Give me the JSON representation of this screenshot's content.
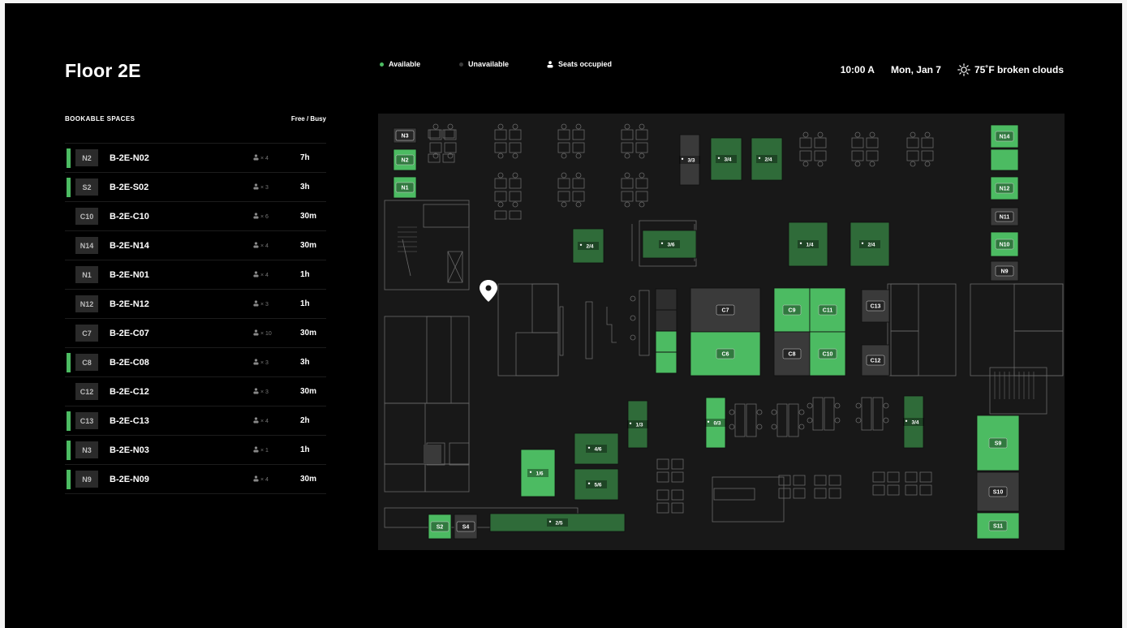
{
  "header": {
    "title": "Floor 2E"
  },
  "legend": [
    {
      "label": "Available",
      "color": "#4cbb62",
      "icon": "dot"
    },
    {
      "label": "Unavailable",
      "color": "#3a3a3a",
      "icon": "dot"
    },
    {
      "label": "Seats occupied",
      "color": "#ffffff",
      "icon": "person-icon"
    }
  ],
  "status": {
    "time": "10:00 A",
    "date": "Mon, Jan 7",
    "weather": "75˚F broken clouds",
    "weather_icon": "sun-icon"
  },
  "list": {
    "heading": "BOOKABLE SPACES",
    "column_label": "Free / Busy",
    "items": [
      {
        "code": "N2",
        "name": "B-2E-N02",
        "capacity": "× 4",
        "duration": "7h",
        "available": true
      },
      {
        "code": "S2",
        "name": "B-2E-S02",
        "capacity": "× 3",
        "duration": "3h",
        "available": true
      },
      {
        "code": "C10",
        "name": "B-2E-C10",
        "capacity": "× 6",
        "duration": "30m",
        "available": false
      },
      {
        "code": "N14",
        "name": "B-2E-N14",
        "capacity": "× 4",
        "duration": "30m",
        "available": false
      },
      {
        "code": "N1",
        "name": "B-2E-N01",
        "capacity": "× 4",
        "duration": "1h",
        "available": false
      },
      {
        "code": "N12",
        "name": "B-2E-N12",
        "capacity": "× 3",
        "duration": "1h",
        "available": false
      },
      {
        "code": "C7",
        "name": "B-2E-C07",
        "capacity": "× 10",
        "duration": "30m",
        "available": false
      },
      {
        "code": "C8",
        "name": "B-2E-C08",
        "capacity": "× 3",
        "duration": "3h",
        "available": true
      },
      {
        "code": "C12",
        "name": "B-2E-C12",
        "capacity": "× 3",
        "duration": "30m",
        "available": false
      },
      {
        "code": "C13",
        "name": "B-2E-C13",
        "capacity": "× 4",
        "duration": "2h",
        "available": true
      },
      {
        "code": "N3",
        "name": "B-2E-N03",
        "capacity": "× 1",
        "duration": "1h",
        "available": true
      },
      {
        "code": "N9",
        "name": "B-2E-N09",
        "capacity": "× 4",
        "duration": "30m",
        "available": true
      }
    ]
  },
  "map": {
    "colors": {
      "available": "#4cbb62",
      "unavailable": "#3a3a3a",
      "occupied": "#2f6b39",
      "floor": "#181818",
      "line": "#6a6a6a"
    },
    "rooms": [
      {
        "label": "N3",
        "state": "unavailable"
      },
      {
        "label": "N2",
        "state": "available"
      },
      {
        "label": "N1",
        "state": "available"
      },
      {
        "label": "N14",
        "state": "available"
      },
      {
        "label": "",
        "state": "available"
      },
      {
        "label": "N12",
        "state": "available"
      },
      {
        "label": "N11",
        "state": "unavailable"
      },
      {
        "label": "N10",
        "state": "available"
      },
      {
        "label": "N9",
        "state": "unavailable"
      },
      {
        "label": "C7",
        "state": "unavailable"
      },
      {
        "label": "C6",
        "state": "available"
      },
      {
        "label": "C9",
        "state": "available"
      },
      {
        "label": "C11",
        "state": "available"
      },
      {
        "label": "C8",
        "state": "unavailable"
      },
      {
        "label": "C10",
        "state": "available"
      },
      {
        "label": "C13",
        "state": "unavailable"
      },
      {
        "label": "C12",
        "state": "unavailable"
      },
      {
        "label": "S9",
        "state": "available"
      },
      {
        "label": "S10",
        "state": "unavailable"
      },
      {
        "label": "S11",
        "state": "available"
      },
      {
        "label": "S2",
        "state": "available"
      },
      {
        "label": "S4",
        "state": "unavailable"
      }
    ],
    "desk_clusters": [
      {
        "label": "3/3",
        "state": "unavailable"
      },
      {
        "label": "3/4",
        "state": "occupied"
      },
      {
        "label": "2/4",
        "state": "occupied"
      },
      {
        "label": "2/4",
        "state": "occupied"
      },
      {
        "label": "3/6",
        "state": "occupied"
      },
      {
        "label": "1/4",
        "state": "occupied"
      },
      {
        "label": "2/4",
        "state": "occupied"
      },
      {
        "label": "1/3",
        "state": "occupied"
      },
      {
        "label": "0/3",
        "state": "available"
      },
      {
        "label": "3/4",
        "state": "occupied"
      },
      {
        "label": "4/6",
        "state": "occupied"
      },
      {
        "label": "5/6",
        "state": "occupied"
      },
      {
        "label": "1/6",
        "state": "available"
      },
      {
        "label": "2/5",
        "state": "occupied"
      }
    ]
  }
}
